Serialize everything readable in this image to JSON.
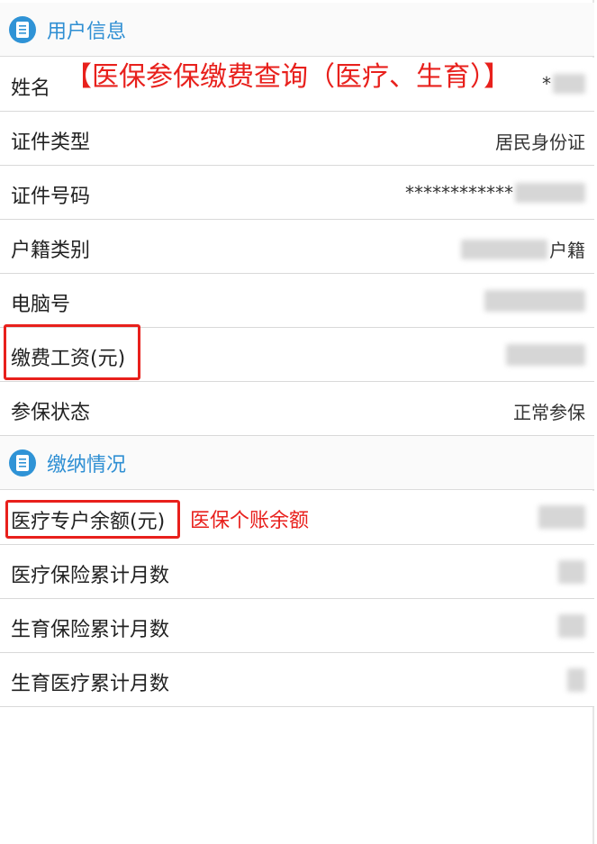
{
  "user_info": {
    "header_title": "用户信息",
    "header_icon": "document-icon",
    "accent_color": "#2f93d6",
    "rows": [
      {
        "label": "姓名",
        "value": "*"
      },
      {
        "label": "证件类型",
        "value": "居民身份证"
      },
      {
        "label": "证件号码",
        "value": "************"
      },
      {
        "label": "户籍类别",
        "value": "户籍"
      },
      {
        "label": "电脑号",
        "value": ""
      },
      {
        "label": "缴费工资(元)",
        "value": ""
      },
      {
        "label": "参保状态",
        "value": "正常参保"
      }
    ]
  },
  "payment_info": {
    "header_title": "缴纳情况",
    "header_icon": "document-icon",
    "rows": [
      {
        "label": "医疗专户余额(元)",
        "value": ""
      },
      {
        "label": "医疗保险累计月数",
        "value": ""
      },
      {
        "label": "生育保险累计月数",
        "value": ""
      },
      {
        "label": "生育医疗累计月数",
        "value": ""
      }
    ]
  },
  "annotations": {
    "title": "【医保参保缴费查询（医疗、生育）】",
    "balance_note": "医保个账余额",
    "color": "#e8201c"
  }
}
